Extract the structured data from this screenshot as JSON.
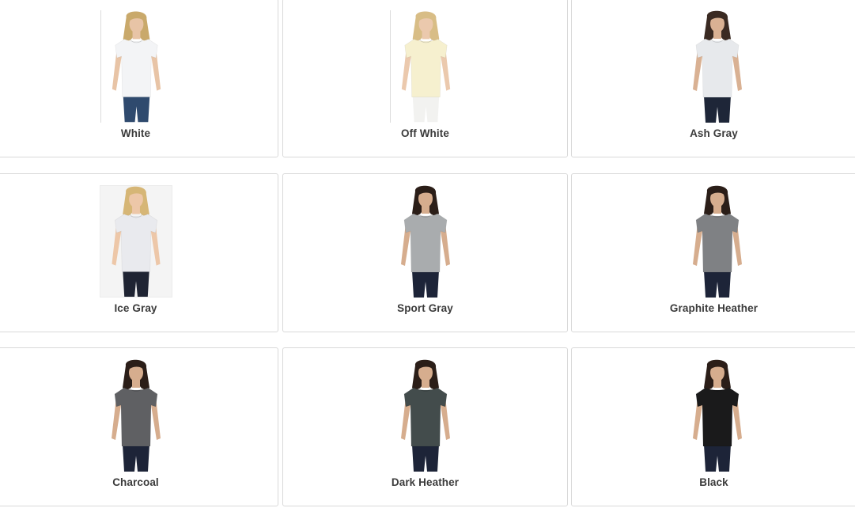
{
  "colors": [
    {
      "name": "White",
      "shirt": "#f3f4f6",
      "hair": "#c9a96b",
      "pants": "#2f4a6e",
      "skin": "#e8c4a6",
      "style": "edge"
    },
    {
      "name": "Off White",
      "shirt": "#f6f0cf",
      "hair": "#d8bd86",
      "pants": "#f2f2f0",
      "skin": "#ebc9ad",
      "style": "edge"
    },
    {
      "name": "Ash Gray",
      "shirt": "#e7e9ec",
      "hair": "#3a2a22",
      "pants": "#1e2638",
      "skin": "#d9b193",
      "style": "plain"
    },
    {
      "name": "Ice Gray",
      "shirt": "#e9eaee",
      "hair": "#d6b676",
      "pants": "#1f2433",
      "skin": "#edc7a8",
      "style": "boxed"
    },
    {
      "name": "Sport Gray",
      "shirt": "#a9acae",
      "hair": "#2b1e18",
      "pants": "#1d2438",
      "skin": "#d6ad8e",
      "style": "plain"
    },
    {
      "name": "Graphite Heather",
      "shirt": "#7f8184",
      "hair": "#2b1e18",
      "pants": "#1d2438",
      "skin": "#d6ad8e",
      "style": "plain"
    },
    {
      "name": "Charcoal",
      "shirt": "#5f6063",
      "hair": "#2b1e18",
      "pants": "#1d2438",
      "skin": "#d6ad8e",
      "style": "plain"
    },
    {
      "name": "Dark Heather",
      "shirt": "#434c4c",
      "hair": "#2b1e18",
      "pants": "#1d2438",
      "skin": "#d6ad8e",
      "style": "plain"
    },
    {
      "name": "Black",
      "shirt": "#1a1a1b",
      "hair": "#2b1e18",
      "pants": "#1d2438",
      "skin": "#d6ad8e",
      "style": "plain"
    }
  ]
}
